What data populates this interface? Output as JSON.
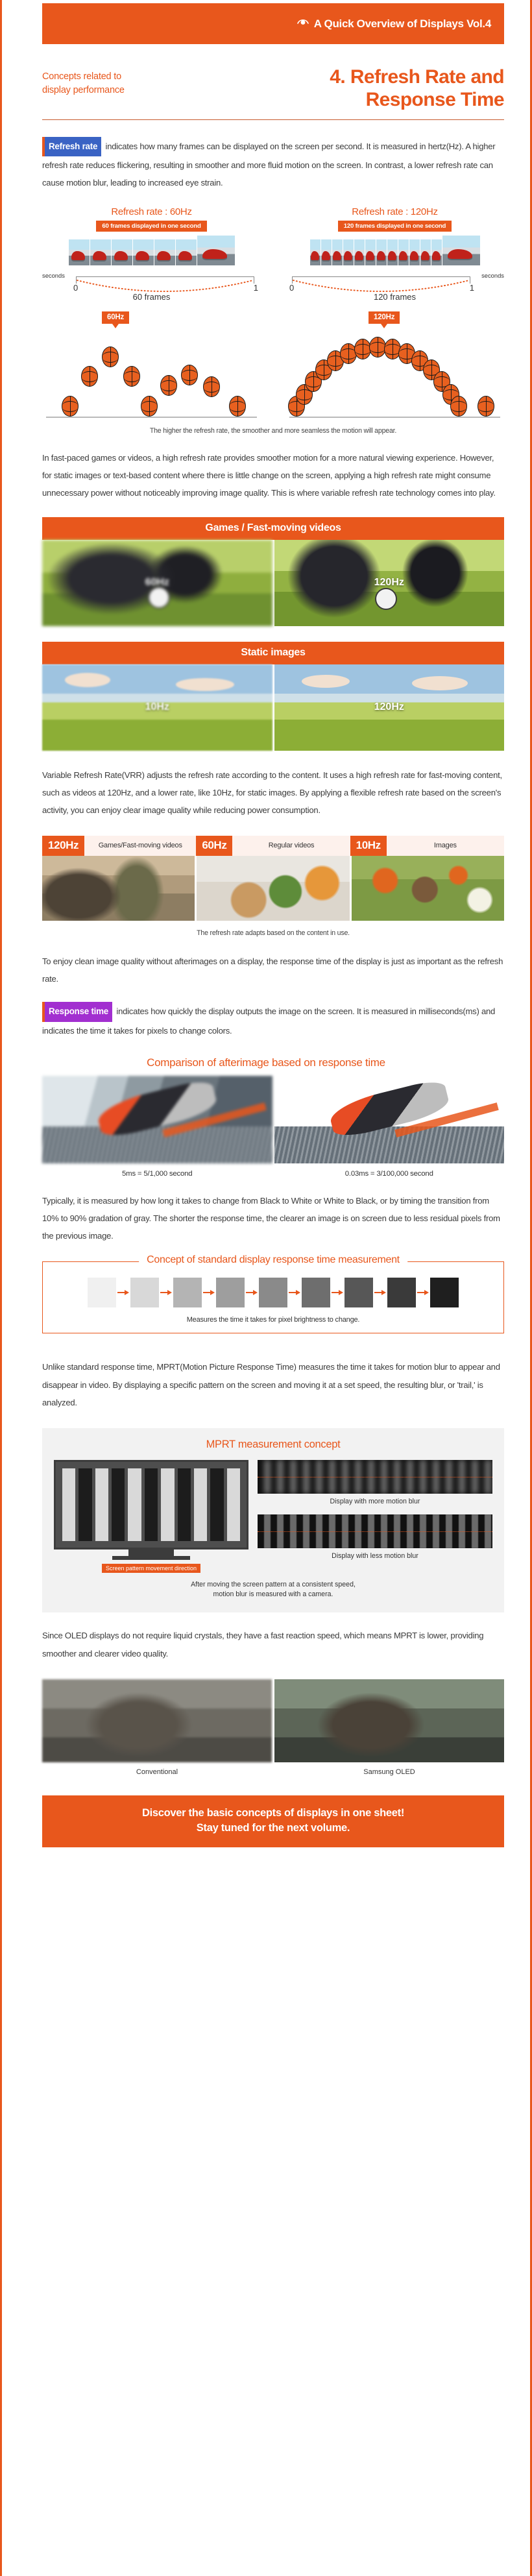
{
  "header": {
    "brand_label": "A Quick Overview of Displays Vol.4",
    "eye_icon": "eye-icon"
  },
  "title": {
    "kicker_line1": "Concepts related to",
    "kicker_line2": "display performance",
    "main_line1": "4. Refresh Rate and",
    "main_line2": "Response Time"
  },
  "intro": {
    "tag": "Refresh rate",
    "text": " indicates how many frames can be displayed on the screen per second. It is measured in hertz(Hz). A higher refresh rate reduces flickering, resulting in smoother and more fluid motion on the screen. In contrast, a lower refresh rate can cause motion blur, leading to increased eye strain."
  },
  "framerate_diagram": {
    "left": {
      "title": "Refresh rate : 60Hz",
      "badge": "60 frames displayed in one second",
      "axis_label": "seconds",
      "axis_start": "0",
      "axis_end": "1",
      "frames_caption": "60 frames"
    },
    "right": {
      "title": "Refresh rate : 120Hz",
      "badge": "120 frames displayed in one second",
      "axis_label": "seconds",
      "axis_start": "0",
      "axis_end": "1",
      "frames_caption": "120 frames"
    }
  },
  "bounce": {
    "left_pin": "60Hz",
    "right_pin": "120Hz",
    "caption": "The higher the refresh rate, the smoother and more seamless the motion will appear."
  },
  "para2": "In fast-paced games or videos, a high refresh rate provides smoother motion for a more natural viewing experience. However, for static images or text-based content where there is little change on the screen, applying a high refresh rate might consume unnecessary power without noticeably improving image quality. This is where variable refresh rate technology comes into play.",
  "compare_games": {
    "heading": "Games / Fast-moving videos",
    "left_label": "60Hz",
    "right_label": "120Hz"
  },
  "compare_static": {
    "heading": "Static images",
    "left_label": "10Hz",
    "right_label": "120Hz"
  },
  "para3": "Variable Refresh Rate(VRR) adjusts the refresh rate according to the content. It uses a high refresh rate for fast-moving content, such as videos at 120Hz, and a lower rate, like 10Hz, for static images. By applying a flexible refresh rate based on the screen's activity, you can enjoy clear image quality while reducing power consumption.",
  "vrr_strip": {
    "cells": [
      {
        "hz": "120Hz",
        "label": "Games/Fast-moving videos"
      },
      {
        "hz": "60Hz",
        "label": "Regular videos"
      },
      {
        "hz": "10Hz",
        "label": "Images"
      }
    ],
    "caption": "The refresh rate adapts based on the content in use."
  },
  "para4": "To enjoy clean image quality without afterimages on a display, the response time of the display is just as important as the refresh rate.",
  "response": {
    "tag": "Response time",
    "text": " indicates how quickly the display outputs the image on the screen. It is measured in milliseconds(ms) and indicates the time it takes for pixels to change colors."
  },
  "afterimage": {
    "title": "Comparison of afterimage based on response time",
    "left_caption": "5ms = 5/1,000 second",
    "right_caption": "0.03ms = 3/100,000 second"
  },
  "para5": "Typically, it is measured by how long it takes to change from Black to White or White to Black, or by timing the transition from 10% to 90% gradation of gray. The shorter the response time, the clearer an image is on screen due to less residual pixels from the previous image.",
  "gray_box": {
    "legend": "Concept of standard display response time measurement",
    "caption": "Measures the time it takes for pixel brightness to change.",
    "swatches": [
      "#f0f0f0",
      "#d8d8d8",
      "#b4b4b4",
      "#9e9e9e",
      "#8a8a8a",
      "#6e6e6e",
      "#575757",
      "#3a3a3a",
      "#1f1f1f"
    ],
    "arrow_color": "#e8571c"
  },
  "para6": "Unlike standard response time, MPRT(Motion Picture Response Time) measures the time it takes for motion blur to appear and disappear in video. By displaying a specific pattern on the screen and moving it at a set speed, the resulting blur, or 'trail,' is analyzed.",
  "mprt": {
    "title": "MPRT measurement concept",
    "sample_more_caption": "Display with more motion blur",
    "sample_less_caption": "Display with less motion blur",
    "direction_tag": "Screen pattern movement direction",
    "note_line1": "After moving the screen pattern at a consistent speed,",
    "note_line2": "motion blur is measured with a camera."
  },
  "para7": "Since OLED displays do not require liquid crystals, they have a fast reaction speed, which means MPRT is lower, providing smoother and clearer video quality.",
  "oled": {
    "left_caption": "Conventional",
    "right_caption": "Samsung OLED"
  },
  "footer": {
    "line1": "Discover the basic concepts of displays in one sheet!",
    "line2": "Stay tuned for the next volume."
  },
  "colors": {
    "brand_orange": "#e8571c",
    "tag_blue": "#3a63c4",
    "tag_purple": "#a22fd0"
  }
}
